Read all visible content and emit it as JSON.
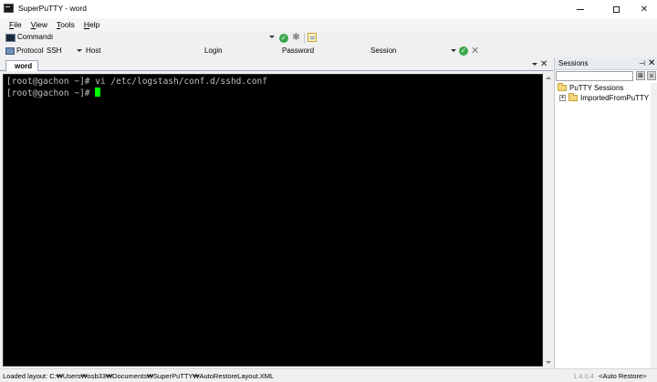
{
  "window": {
    "title": "SuperPuTTY - word",
    "app_icon": "terminal-icon"
  },
  "menu": {
    "items": [
      {
        "label": "File",
        "underline": "F",
        "rest": "ile"
      },
      {
        "label": "View",
        "underline": "V",
        "rest": "iew"
      },
      {
        "label": "Tools",
        "underline": "T",
        "rest": "ools"
      },
      {
        "label": "Help",
        "underline": "H",
        "rest": "elp"
      }
    ]
  },
  "commands": {
    "label": "Commands",
    "value": ""
  },
  "connection": {
    "protocol_label": "Protocol",
    "protocol_value": "SSH",
    "host_label": "Host",
    "login_label": "Login",
    "password_label": "Password",
    "session_label": "Session"
  },
  "tabs": [
    {
      "label": "word",
      "active": true
    }
  ],
  "terminal": {
    "lines": [
      "[root@gachon ~]# vi /etc/logstash/conf.d/sshd.conf",
      "[root@gachon ~]# "
    ],
    "cursor_color": "#00ff00",
    "background": "#000000",
    "text_color": "#bfbfbf"
  },
  "sessions_panel": {
    "title": "Sessions",
    "search_value": "",
    "tree": {
      "root": "PuTTY Sessions",
      "children": [
        {
          "label": "ImportedFromPuTTY",
          "expand_symbol": "+"
        }
      ]
    }
  },
  "status": {
    "left": "Loaded layout: C:₩Users₩osb33₩Documents₩SuperPuTTY₩AutoRestoreLayout.XML",
    "version": "1.4.0.4",
    "restore": "<Auto Restore>"
  }
}
